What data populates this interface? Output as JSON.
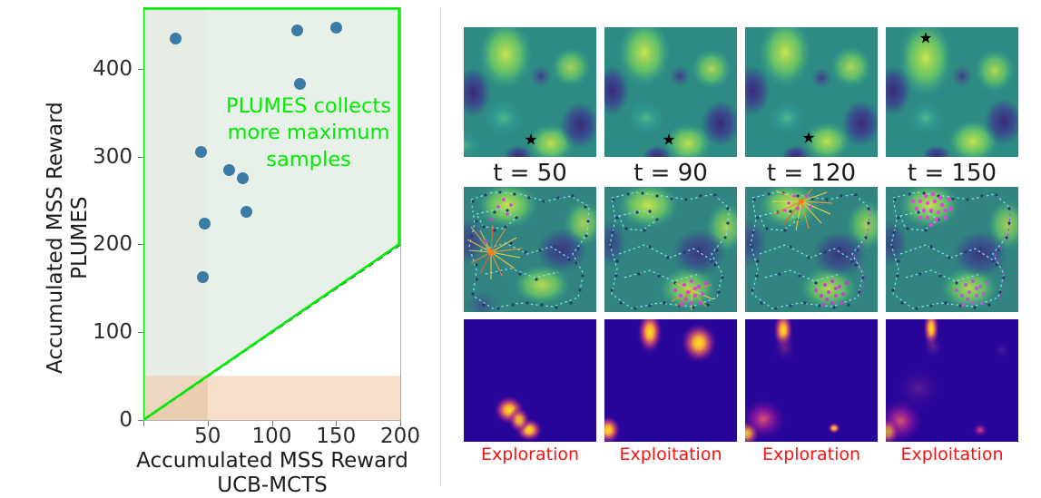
{
  "figure": {
    "panels": [
      "scatter-comparison",
      "timeseries-grid"
    ]
  },
  "scatter": {
    "xlabel_line1": "Accumulated MSS Reward",
    "xlabel_line2": "UCB-MCTS",
    "ylabel_line1": "Accumulated MSS Reward",
    "ylabel_line2": "PLUMES",
    "annotation_line1": "PLUMES collects",
    "annotation_line2": "more  maximum",
    "annotation_line3": "samples",
    "annotation_color": "#00ec00",
    "marker_color": "#3a7ca5",
    "region_upper_color": "#e6efe8",
    "region_left_color": "#e0d3b8",
    "region_bottom_color": "#f7dfd0",
    "diagonal_color": "#00ec00",
    "diagonal_dash_color": "#2f3f5f",
    "xticks": [
      "0",
      "50",
      "100",
      "150",
      "200"
    ],
    "yticks": [
      "0",
      "100",
      "200",
      "300",
      "400"
    ]
  },
  "chart_data": {
    "type": "scatter",
    "title": "",
    "xlabel": "Accumulated MSS Reward UCB-MCTS",
    "ylabel": "Accumulated MSS Reward PLUMES",
    "xlim": [
      0,
      200
    ],
    "ylim": [
      0,
      470
    ],
    "xticks": [
      0,
      50,
      100,
      150,
      200
    ],
    "yticks": [
      0,
      100,
      200,
      300,
      400
    ],
    "grid": false,
    "legend": "none",
    "x": [
      25,
      120,
      150,
      122,
      45,
      67,
      77,
      80,
      48,
      46
    ],
    "y": [
      434,
      444,
      447,
      383,
      305,
      284,
      275,
      237,
      224,
      163
    ],
    "annotations": [
      {
        "text": "PLUMES collects more  maximum samples",
        "x": 105,
        "y": 355,
        "color": "#00ec00"
      }
    ],
    "shaded_regions": [
      {
        "name": "plumes-advantage-polygon",
        "color": "#e6efe8",
        "edge": "#00ec00",
        "vertices": [
          [
            0,
            0
          ],
          [
            0,
            470
          ],
          [
            200,
            470
          ],
          [
            200,
            200
          ]
        ]
      },
      {
        "name": "ucb-low-reward-band",
        "color": "#e0d3b8",
        "x_range": [
          0,
          50
        ],
        "y_range": [
          0,
          470
        ]
      },
      {
        "name": "plumes-low-reward-band",
        "color": "#f7dfd0",
        "x_range": [
          0,
          200
        ],
        "y_range": [
          0,
          50
        ]
      }
    ],
    "reference_line": {
      "name": "y=x parity line",
      "from": [
        0,
        0
      ],
      "to": [
        200,
        200
      ],
      "style": "dashed"
    }
  },
  "grid": {
    "columns": [
      {
        "time_label": "t = 50",
        "phase_label": "Exploration"
      },
      {
        "time_label": "t = 90",
        "phase_label": "Exploitation"
      },
      {
        "time_label": "t = 120",
        "phase_label": "Exploration"
      },
      {
        "time_label": "t = 150",
        "phase_label": "Exploitation"
      }
    ],
    "rows": [
      {
        "name": "belief-mean-map",
        "colormap": "viridis",
        "marker": "star-maximum"
      },
      {
        "name": "trajectory-map",
        "colormap": "viridis",
        "overlay": "robot-path-and-samples"
      },
      {
        "name": "acquisition-map",
        "colormap": "plasma"
      }
    ],
    "star_glyph": "★",
    "phase_label_color": "#fd1111",
    "time_label_color": "#1b1b1b"
  }
}
